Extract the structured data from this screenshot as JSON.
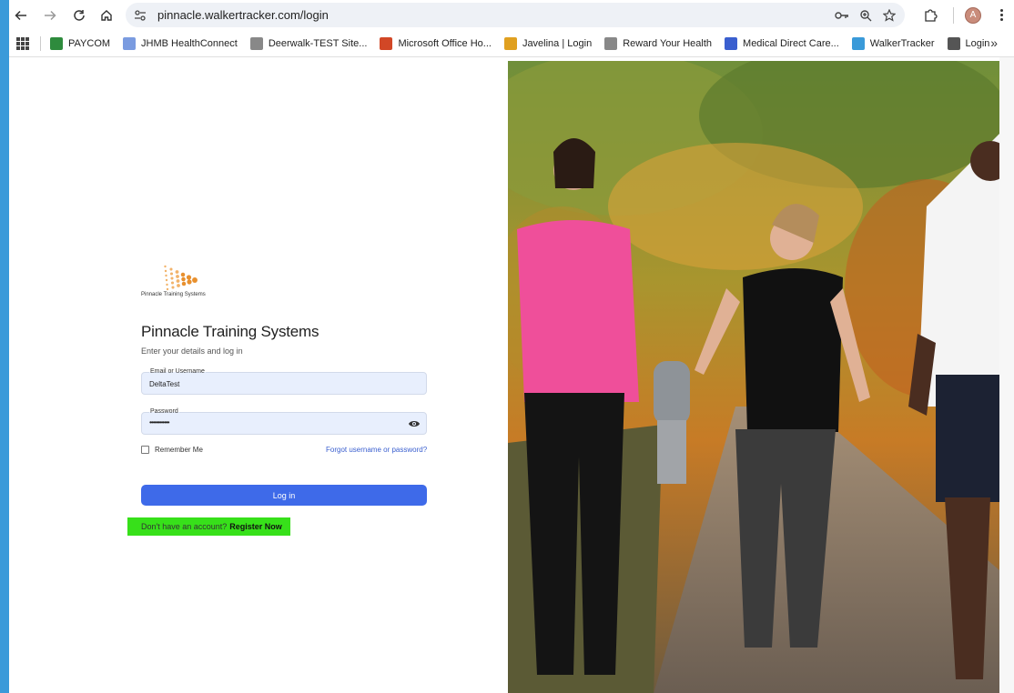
{
  "browser": {
    "url": "pinnacle.walkertracker.com/login",
    "profile_initial": "A"
  },
  "bookmarks": [
    {
      "label": "PAYCOM",
      "icon": "paycom-icon",
      "color": "#2e8b3d"
    },
    {
      "label": "JHMB HealthConnect",
      "icon": "health-icon",
      "color": "#7a9be0"
    },
    {
      "label": "Deerwalk-TEST Site...",
      "icon": "globe-icon",
      "color": "#888888"
    },
    {
      "label": "Microsoft Office Ho...",
      "icon": "office-icon",
      "color": "#d24726"
    },
    {
      "label": "Javelina | Login",
      "icon": "javelina-icon",
      "color": "#e0a020"
    },
    {
      "label": "Reward Your Health",
      "icon": "reward-icon",
      "color": "#888888"
    },
    {
      "label": "Medical Direct Care...",
      "icon": "medical-icon",
      "color": "#3a5fcf"
    },
    {
      "label": "WalkerTracker",
      "icon": "walker-icon",
      "color": "#3a9ad9"
    },
    {
      "label": "Login",
      "icon": "login-globe-icon",
      "color": "#555555"
    }
  ],
  "login": {
    "logo_text": "Pinnacle Training Systems",
    "title": "Pinnacle Training Systems",
    "subtitle": "Enter your details and log in",
    "email_label": "Email or Username",
    "email_value": "DeltaTest",
    "password_label": "Password",
    "password_value": "••••••••••••",
    "remember_label": "Remember Me",
    "forgot_label": "Forgot username or password?",
    "login_label": "Log in",
    "register_prompt": "Don't have an account?",
    "register_label": "Register Now"
  },
  "colors": {
    "accent": "#3e6ae9",
    "highlight": "#37e01a",
    "input_bg": "#e8effd"
  }
}
